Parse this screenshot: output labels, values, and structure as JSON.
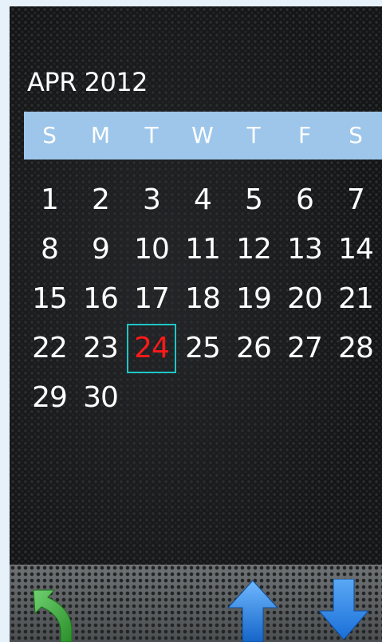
{
  "calendar": {
    "month_label": "APR 2012",
    "weekdays": [
      "S",
      "M",
      "T",
      "W",
      "T",
      "F",
      "S"
    ],
    "weeks": [
      [
        "1",
        "2",
        "3",
        "4",
        "5",
        "6",
        "7"
      ],
      [
        "8",
        "9",
        "10",
        "11",
        "12",
        "13",
        "14"
      ],
      [
        "15",
        "16",
        "17",
        "18",
        "19",
        "20",
        "21"
      ],
      [
        "22",
        "23",
        "24",
        "25",
        "26",
        "27",
        "28"
      ],
      [
        "29",
        "30",
        "",
        "",
        "",
        "",
        ""
      ]
    ],
    "today": "24"
  },
  "colors": {
    "weekday_bar": "#9dc6ea",
    "today_text": "#ff1a1a",
    "today_border": "#1fc6c6",
    "back_arrow": "#3da83d",
    "nav_arrow": "#1e7fe0"
  },
  "toolbar": {
    "back_icon": "back-arrow-icon",
    "up_icon": "arrow-up-icon",
    "down_icon": "arrow-down-icon"
  }
}
